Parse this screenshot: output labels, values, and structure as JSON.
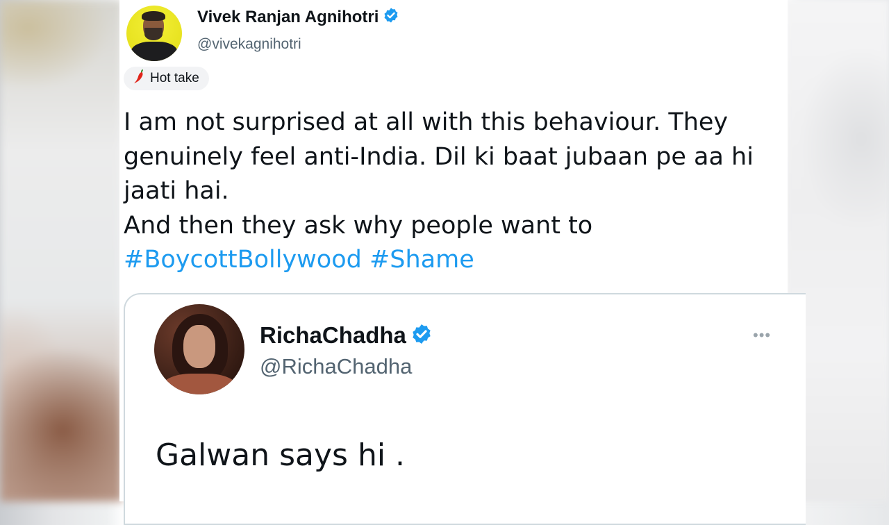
{
  "tweet": {
    "author_name": "Vivek Ranjan Agnihotri",
    "author_handle": "@vivekagnihotri",
    "badge": "Hot take",
    "text_lines": [
      "I am not surprised at all with this behaviour. They",
      "genuinely feel anti-India. Dil ki baat jubaan pe aa hi",
      "jaati hai.",
      "And then they ask why people want to"
    ],
    "hashtags": [
      "#BoycottBollywood",
      "#Shame"
    ]
  },
  "quoted_tweet": {
    "author_name": "RichaChadha",
    "author_handle": "@RichaChadha",
    "text": "Galwan says hi ."
  },
  "icons": {
    "verified": "verified-badge-icon",
    "chili": "chili-pepper-icon",
    "more": "more-options-icon"
  },
  "colors": {
    "verified_blue": "#1d9bf0",
    "hashtag_blue": "#1d9bf0",
    "text": "#0f1419",
    "secondary_text": "#536471",
    "chili_red": "#e0251b"
  }
}
